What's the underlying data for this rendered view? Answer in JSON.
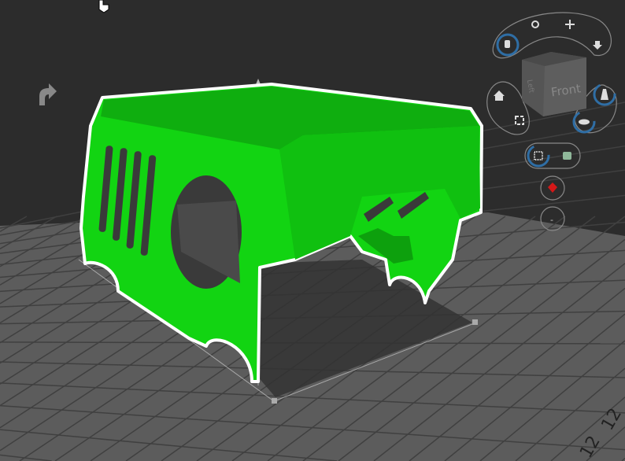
{
  "viewport": {
    "background": "#2c2c2c",
    "bed_color": "#5c5c5c",
    "grid_color": "#3e3e3e",
    "model_color": "#11d411",
    "model_top_color": "#0fb80f",
    "outline_color": "#ffffff",
    "bed_label": "12",
    "bed_label_2": "12"
  },
  "view_cube": {
    "face_front": "Front",
    "face_left": "Left"
  },
  "controls": {
    "rotate": "rotate-icon",
    "move": "move-icon",
    "pan_hand": "hand-icon",
    "drop": "drop-to-bed-icon",
    "home": "home-icon",
    "fit": "fit-view-icon",
    "layers": "layers-icon",
    "bed": "bed-icon",
    "grid": "grid-icon",
    "solid": "solid-view-icon",
    "color": "color-icon",
    "minus_label": "-"
  },
  "accent": "#2f6ea5"
}
